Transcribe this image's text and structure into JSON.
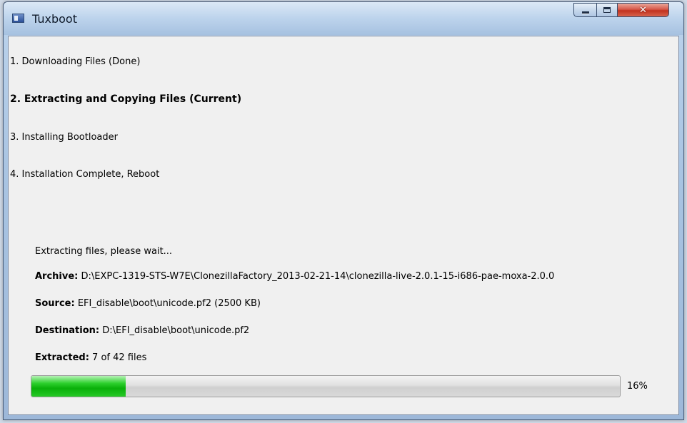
{
  "window": {
    "title": "Tuxboot"
  },
  "steps": [
    {
      "label": "1. Downloading Files (Done)",
      "state": "done"
    },
    {
      "label": "2. Extracting and Copying Files (Current)",
      "state": "current"
    },
    {
      "label": "3. Installing Bootloader",
      "state": "pending"
    },
    {
      "label": "4. Installation Complete, Reboot",
      "state": "pending"
    }
  ],
  "status": {
    "message": "Extracting files, please wait...",
    "archive_label": "Archive:",
    "archive_value": "D:\\EXPC-1319-STS-W7E\\ClonezillaFactory_2013-02-21-14\\clonezilla-live-2.0.1-15-i686-pae-moxa-2.0.0",
    "source_label": "Source:",
    "source_value": "EFI_disable\\boot\\unicode.pf2 (2500 KB)",
    "destination_label": "Destination:",
    "destination_value": "D:\\EFI_disable\\boot\\unicode.pf2",
    "extracted_label": "Extracted:",
    "extracted_value": "7 of 42 files"
  },
  "progress": {
    "percent_text": "16%",
    "fraction": 0.16,
    "fill_color": "#16b816"
  },
  "icons": {
    "app": "tuxboot-app-icon",
    "minimize": "minimize-icon",
    "maximize": "maximize-icon",
    "close": "close-icon"
  }
}
